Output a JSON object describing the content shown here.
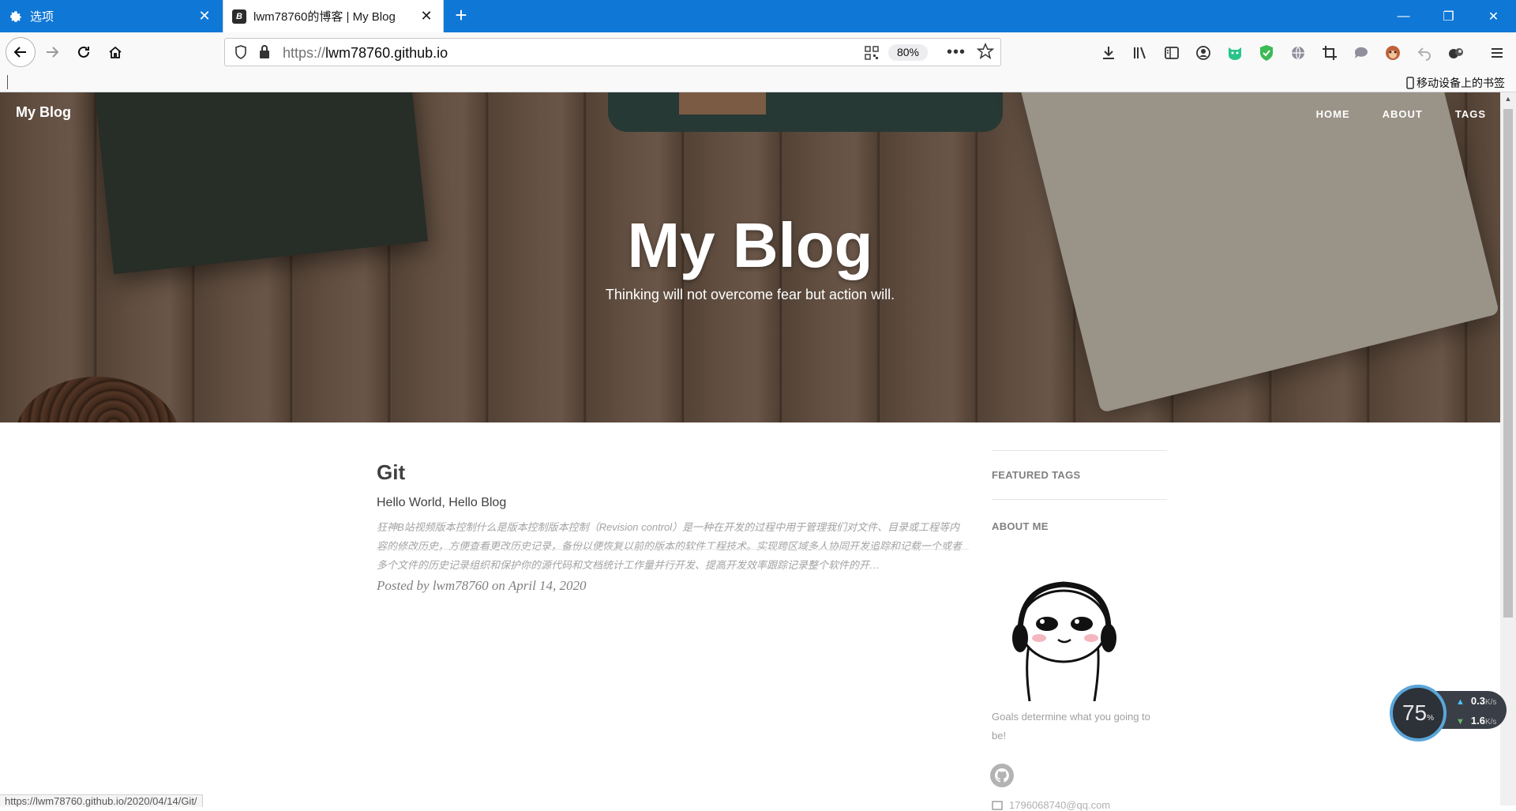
{
  "browser": {
    "tabs": [
      {
        "title": "选项",
        "active": false
      },
      {
        "title": "lwm78760的博客 | My Blog",
        "active": true
      }
    ],
    "url_scheme": "https://",
    "url_host": "lwm78760.github.io",
    "zoom": "80%",
    "bookmarks": {
      "mobile_label": "移动设备上的书签"
    },
    "status_url": "https://lwm78760.github.io/2020/04/14/Git/"
  },
  "site": {
    "brand": "My Blog",
    "nav": [
      "HOME",
      "ABOUT",
      "TAGS"
    ],
    "hero_title": "My Blog",
    "hero_subtitle": "Thinking will not overcome fear but action will."
  },
  "post": {
    "title": "Git",
    "subtitle": "Hello World, Hello Blog",
    "excerpt": "狂神B站视频版本控制什么是版本控制版本控制（Revision control）是一种在开发的过程中用于管理我们对文件、目录或工程等内容的修改历史，方便查看更改历史记录，备份以便恢复以前的版本的软件工程技术。实现跨区域多人协同开发追踪和记载一个或者多个文件的历史记录组织和保护你的源代码和文档统计工作量并行开发、提高开发效率跟踪记录整个软件的开…",
    "meta": "Posted by lwm78760 on April 14, 2020"
  },
  "sidebar": {
    "featured_tags_heading": "FEATURED TAGS",
    "about_heading": "ABOUT ME",
    "about_text": "Goals determine what you going to be!",
    "email": "1796068740@qq.com"
  },
  "speed_widget": {
    "percent": "75",
    "percent_sign": "%",
    "upload": "0.3",
    "download": "1.6",
    "unit": "K/s"
  },
  "colors": {
    "titlebar": "#0f77d6",
    "toolbar": "#f9f9fa",
    "heading_text": "#404040",
    "muted_text": "#a3a3a3"
  }
}
